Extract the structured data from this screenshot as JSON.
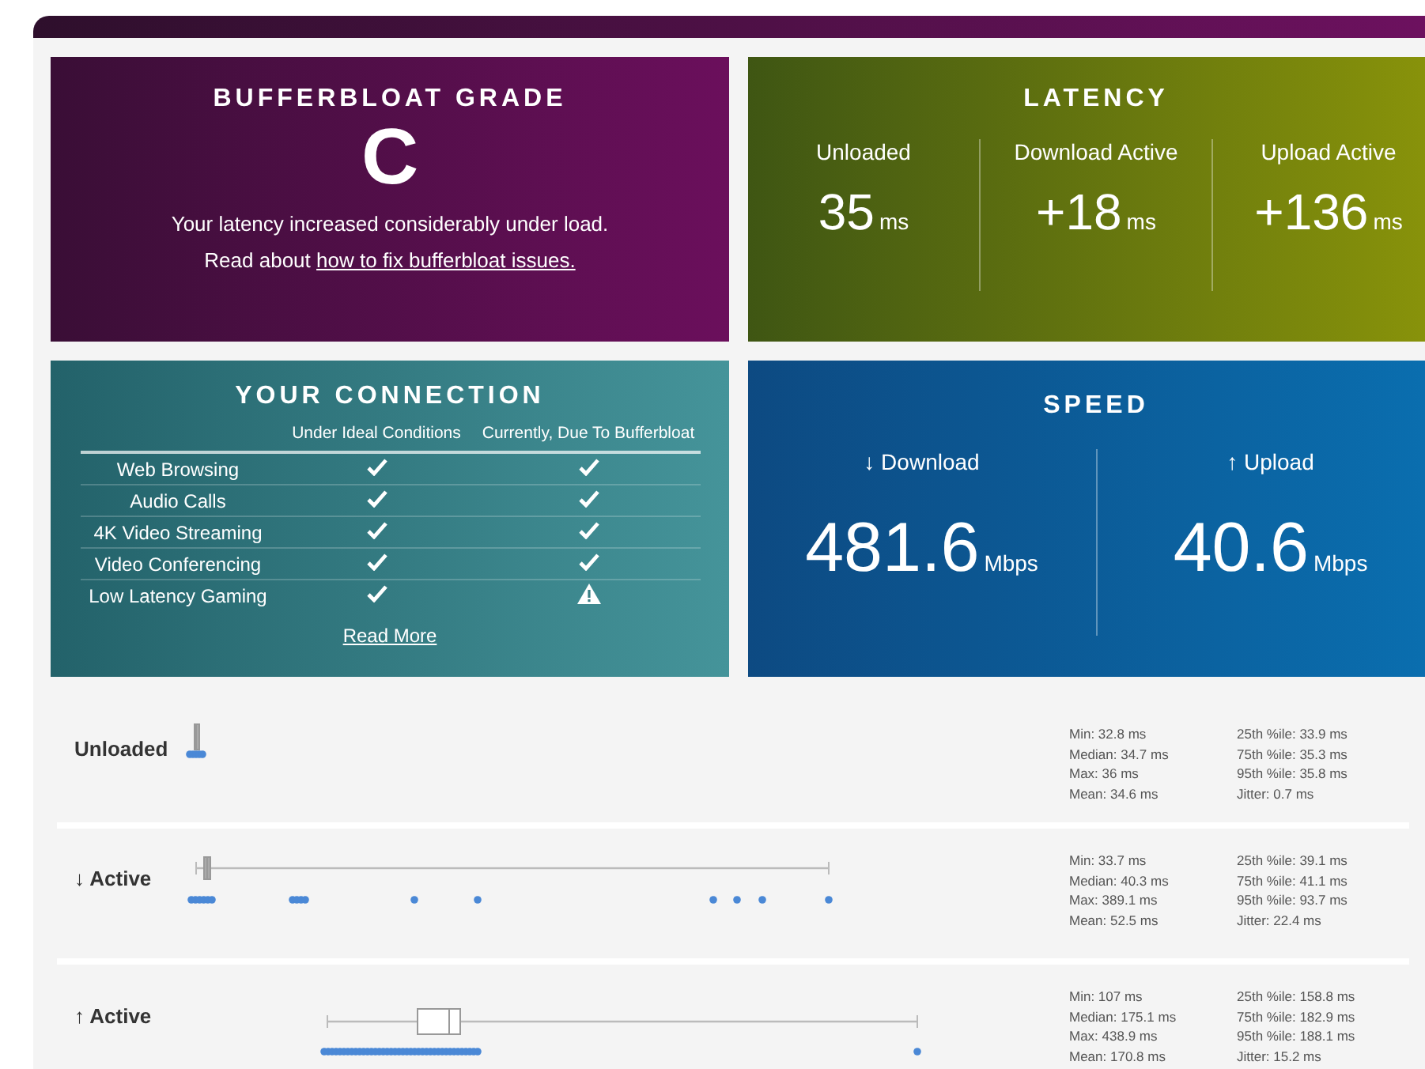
{
  "grade": {
    "title": "BUFFERBLOAT GRADE",
    "grade": "C",
    "message": "Your latency increased considerably under load.",
    "read_prefix": "Read about",
    "link": "how to fix bufferbloat issues."
  },
  "latency": {
    "title": "LATENCY",
    "columns": [
      {
        "label": "Unloaded",
        "value": "35",
        "unit": "ms"
      },
      {
        "label": "Download Active",
        "value": "+18",
        "unit": "ms"
      },
      {
        "label": "Upload Active",
        "value": "+136",
        "unit": "ms"
      }
    ]
  },
  "connection": {
    "title": "YOUR CONNECTION",
    "headers": [
      "Under Ideal Conditions",
      "Currently, Due To Bufferbloat"
    ],
    "rows": [
      {
        "label": "Web Browsing",
        "ideal_ok": true,
        "current_ok": true
      },
      {
        "label": "Audio Calls",
        "ideal_ok": true,
        "current_ok": true
      },
      {
        "label": "4K Video Streaming",
        "ideal_ok": true,
        "current_ok": true
      },
      {
        "label": "Video Conferencing",
        "ideal_ok": true,
        "current_ok": true
      },
      {
        "label": "Low Latency Gaming",
        "ideal_ok": true,
        "current_ok": false
      }
    ],
    "link": "Read More"
  },
  "speed": {
    "title": "SPEED",
    "columns": [
      {
        "label": "↓ Download",
        "value": "481.6",
        "unit": "Mbps"
      },
      {
        "label": "↑ Upload",
        "value": "40.6",
        "unit": "Mbps"
      }
    ]
  },
  "distributions": [
    {
      "label": "Unloaded",
      "stats": [
        "Min: 32.8 ms",
        "Median: 34.7 ms",
        "Max: 36 ms",
        "Mean: 34.6 ms",
        "25th %ile: 33.9 ms",
        "75th %ile: 35.3 ms",
        "95th %ile: 35.8 ms",
        "Jitter: 0.7 ms"
      ]
    },
    {
      "label": "↓ Active",
      "stats": [
        "Min: 33.7 ms",
        "Median: 40.3 ms",
        "Max: 389.1 ms",
        "Mean: 52.5 ms",
        "25th %ile: 39.1 ms",
        "75th %ile: 41.1 ms",
        "95th %ile: 93.7 ms",
        "Jitter: 22.4 ms"
      ]
    },
    {
      "label": "↑ Active",
      "stats": [
        "Min: 107 ms",
        "Median: 175.1 ms",
        "Max: 438.9 ms",
        "Mean: 170.8 ms",
        "25th %ile: 158.8 ms",
        "75th %ile: 182.9 ms",
        "95th %ile: 188.1 ms",
        "Jitter: 15.2 ms"
      ]
    }
  ]
}
